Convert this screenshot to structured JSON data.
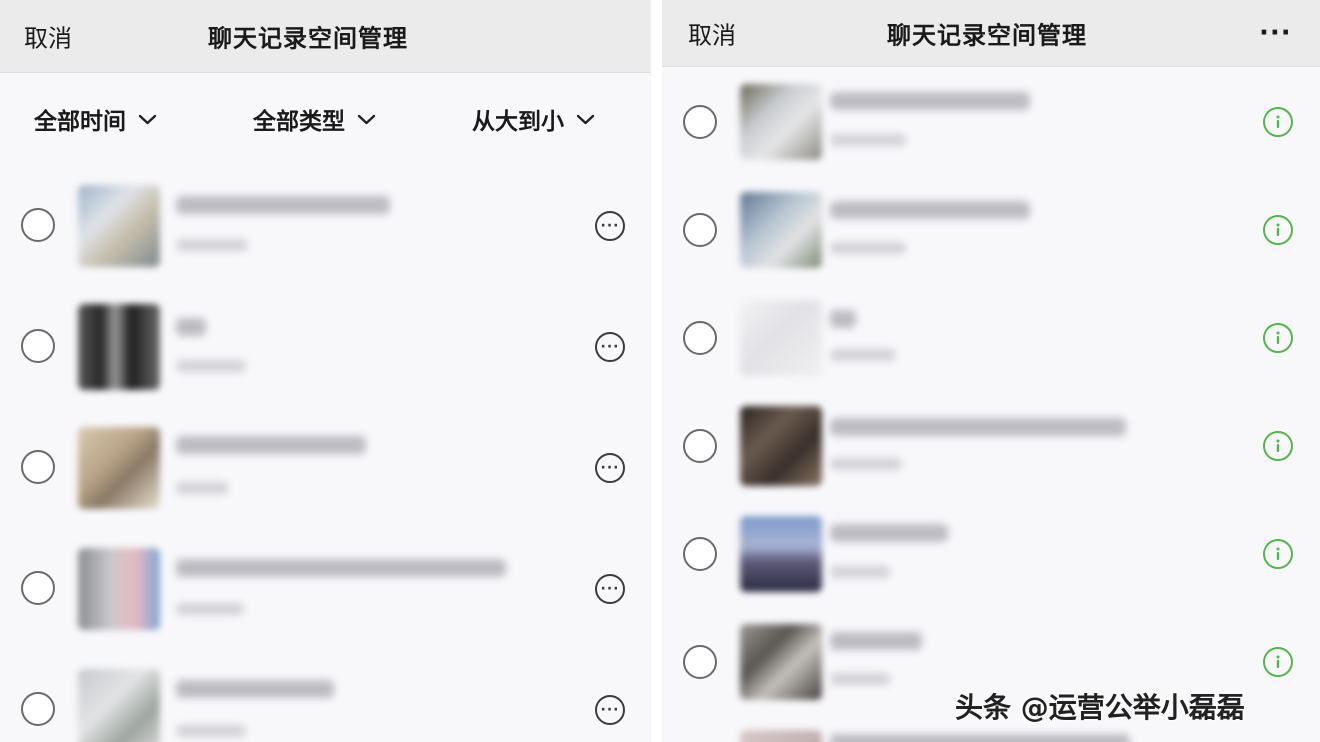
{
  "left_panel": {
    "header": {
      "cancel_label": "取消",
      "title": "聊天记录空间管理"
    },
    "filters": [
      {
        "label": "全部时间"
      },
      {
        "label": "全部类型"
      },
      {
        "label": "从大到小"
      }
    ],
    "rows_count_visible": 5,
    "row_action_icon": "more-options-icon"
  },
  "right_panel": {
    "header": {
      "cancel_label": "取消",
      "title": "聊天记录空间管理",
      "more_label": "···"
    },
    "rows_count_visible": 6,
    "row_action_icon": "info-icon"
  },
  "watermark": {
    "text": "头条 @运营公举小磊磊"
  },
  "colors": {
    "header_bg": "#ebebeb",
    "info_accent": "#52b64a",
    "page_bg": "#f8f8fb"
  }
}
